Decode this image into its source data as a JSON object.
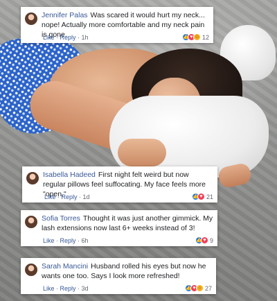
{
  "comments": [
    {
      "name": "Jennifer Palas",
      "text": "Was scared it would hurt my neck... nope! Actually more comfortable and my neck pain is gone.",
      "like": "Like",
      "reply": "Reply",
      "time": "1h",
      "reactions": [
        "like-icon",
        "love-icon",
        "haha-icon"
      ],
      "count": "12"
    },
    {
      "name": "Isabella Hadeed",
      "text": "First night felt weird but now regular pillows feel suffocating. My face feels more \"open.\"",
      "like": "Like",
      "reply": "Reply",
      "time": "1d",
      "reactions": [
        "like-icon",
        "love-icon"
      ],
      "count": "21"
    },
    {
      "name": "Sofia Torres",
      "text": "Thought it was just another gimmick. My lash extensions now last 6+ weeks instead of 3!",
      "like": "Like",
      "reply": "Reply",
      "time": "6h",
      "reactions": [
        "like-icon",
        "love-icon"
      ],
      "count": "9"
    },
    {
      "name": "Sarah Mancini",
      "text": "Husband rolled his eyes but now he wants one too. Says I look more refreshed!",
      "like": "Like",
      "reply": "Reply",
      "time": "3d",
      "reactions": [
        "like-icon",
        "love-icon",
        "wow-icon"
      ],
      "count": "27"
    }
  ],
  "colors": {
    "name": "#385898",
    "text": "#1c1e21",
    "meta": "#606770",
    "like": "#1877f2",
    "love": "#f33e58",
    "haha": "#f7b125"
  }
}
